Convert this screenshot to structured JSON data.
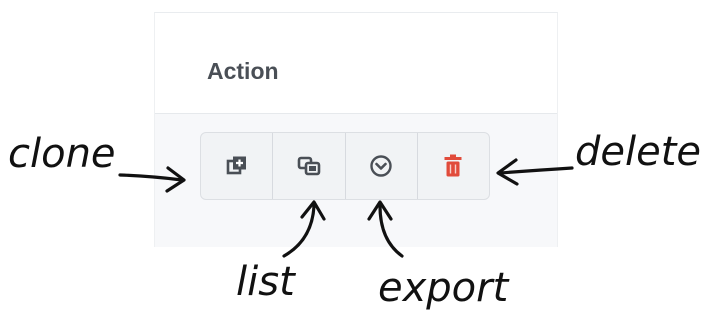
{
  "table": {
    "header_label": "Action",
    "buttons": [
      {
        "id": "clone",
        "icon": "clone-icon",
        "color": "#4a4f56"
      },
      {
        "id": "list",
        "icon": "list-icon",
        "color": "#4a4f56"
      },
      {
        "id": "export",
        "icon": "chevron-circle-down-icon",
        "color": "#4a4f56"
      },
      {
        "id": "delete",
        "icon": "trash-icon",
        "color": "#e14b3b"
      }
    ]
  },
  "annotations": {
    "clone": "clone",
    "list": "list",
    "export": "export",
    "delete": "delete"
  }
}
